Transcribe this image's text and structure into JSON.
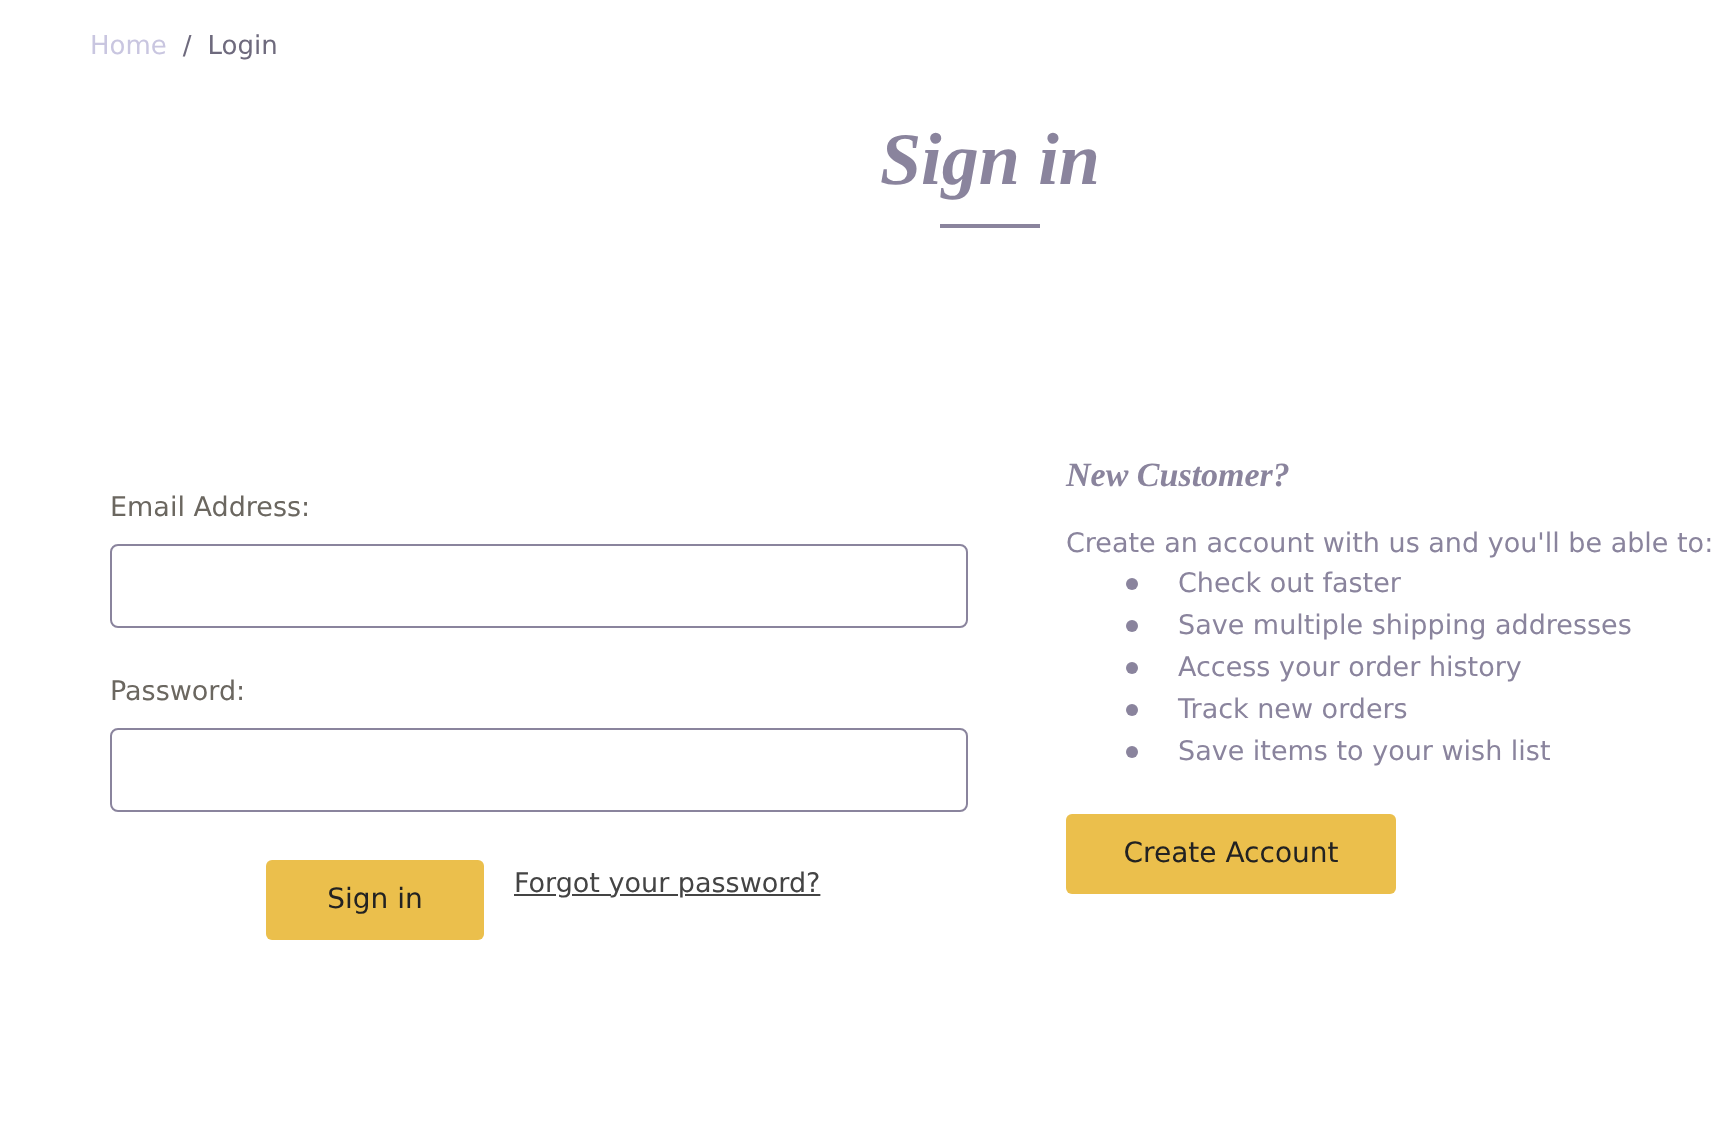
{
  "breadcrumb": [
    {
      "label": "Home",
      "selected": false
    },
    {
      "label": "Login",
      "selected": true
    }
  ],
  "breadcrumb_separator": "/",
  "title": "Sign in",
  "login_form": {
    "fields": [
      {
        "label": "Email Address:"
      },
      {
        "label": "Password:"
      }
    ],
    "submit": "Sign in",
    "forgot_link": "Forgot your password?"
  },
  "new_customer": {
    "heading": "New Customer?",
    "intro": "Create an account with us and you'll be able to:",
    "benefits": [
      "Check out faster",
      "Save multiple shipping addresses",
      "Access your order history",
      "Track new orders",
      "Save items to your wish list"
    ],
    "button": "Create Account"
  }
}
